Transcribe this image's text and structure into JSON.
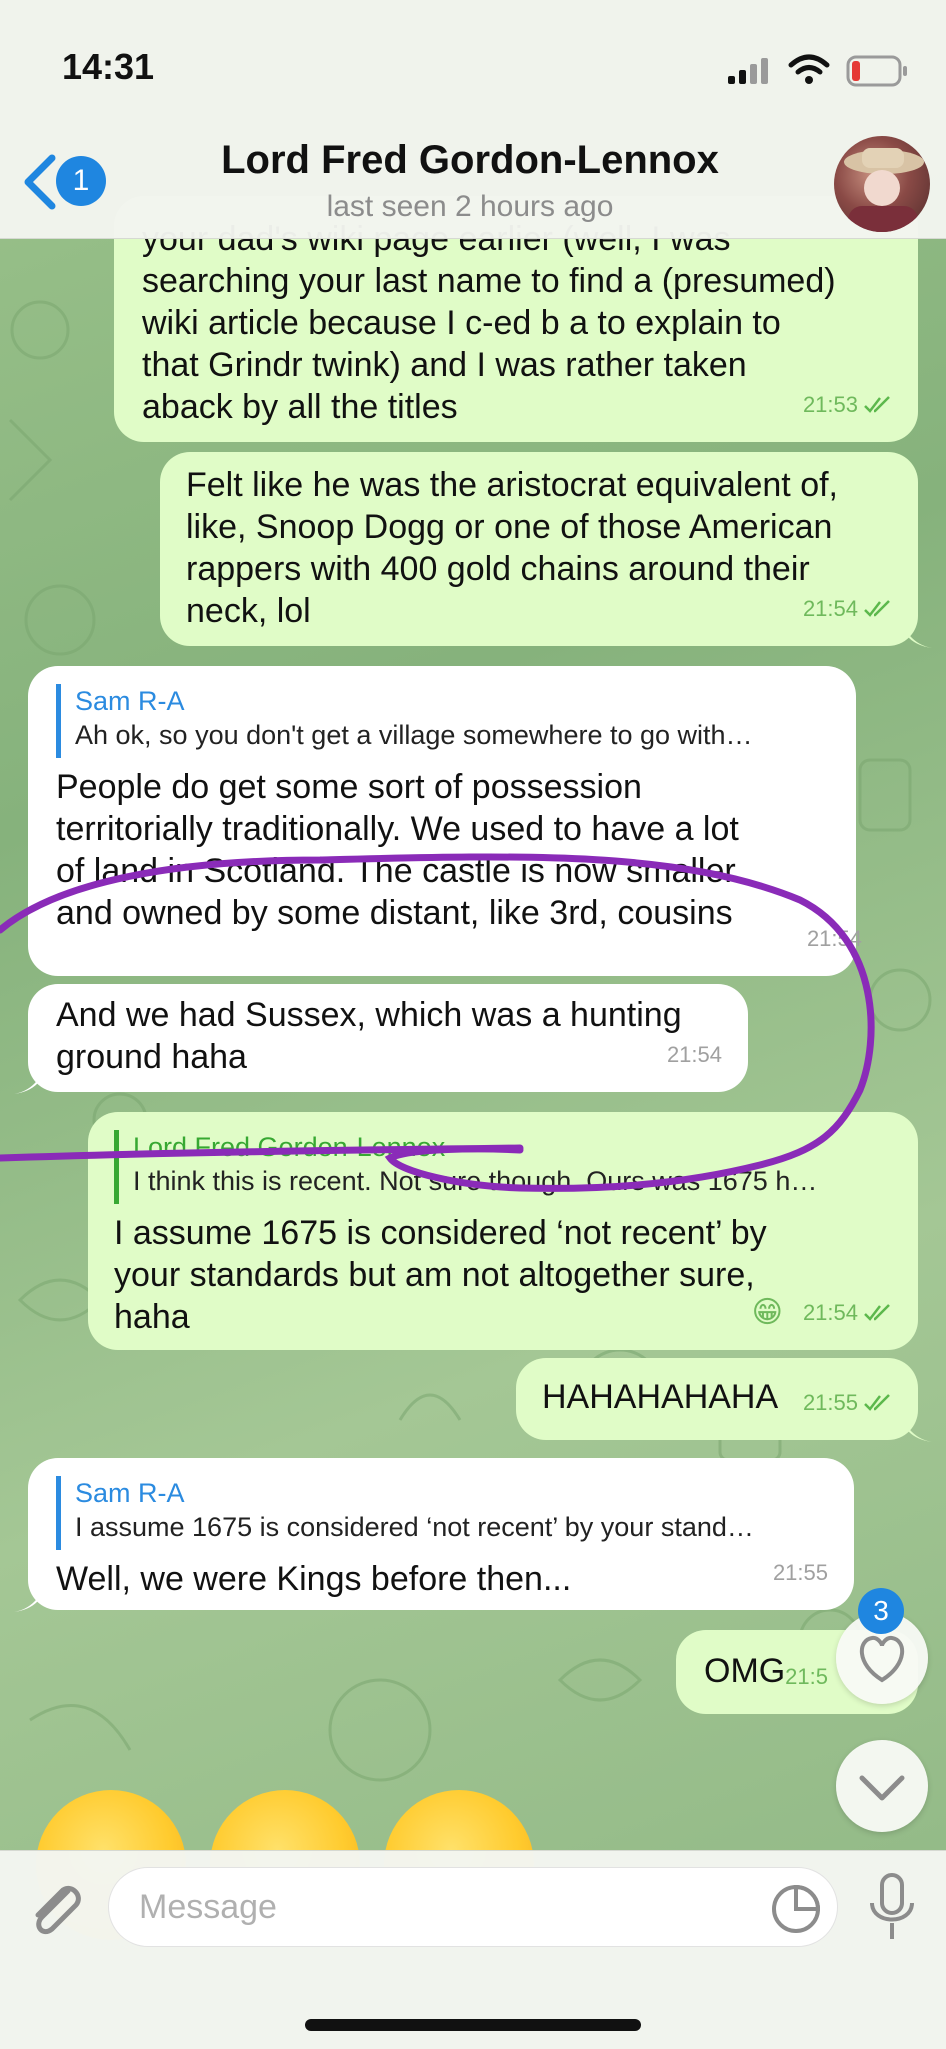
{
  "status_bar": {
    "time": "14:31"
  },
  "header": {
    "back_count": "1",
    "contact_name": "Lord Fred Gordon-Lennox",
    "last_seen": "last seen 2 hours ago"
  },
  "messages": [
    {
      "direction": "outgoing",
      "text_lines": [
        "your dad's wiki page earlier (well, I was",
        "searching your last name to find a (presumed)",
        "wiki article because I c-ed b a to explain to",
        "that Grindr twink) and I was rather taken",
        "aback by all the titles"
      ],
      "time": "21:53"
    },
    {
      "direction": "outgoing",
      "text_lines": [
        "Felt like he was the aristocrat equivalent of,",
        "like, Snoop Dogg or one of those American",
        "rappers with 400 gold chains around their",
        "neck, lol"
      ],
      "time": "21:54"
    },
    {
      "direction": "incoming",
      "reply_name": "Sam R-A",
      "reply_text": "Ah ok, so you don't get a village somewhere to go with…",
      "text_lines": [
        "People do get some sort of possession",
        "territorially traditionally. We used to have a lot",
        "of land in Scotland. The castle is now smaller",
        "and owned by some distant, like 3rd, cousins"
      ],
      "time": "21:54"
    },
    {
      "direction": "incoming",
      "text_lines": [
        "And we had Sussex, which was a hunting",
        "ground haha"
      ],
      "time": "21:54"
    },
    {
      "direction": "outgoing",
      "reply_name": "Lord Fred Gordon-Lennox",
      "reply_text": "I think this is recent. Not sure though. Ours was 1675 h…",
      "text_lines": [
        "I assume 1675 is considered ‘not recent’ by",
        "your standards but am not altogether sure,",
        "haha"
      ],
      "reaction": "😁",
      "time": "21:54"
    },
    {
      "direction": "outgoing",
      "text_lines": [
        "HAHAHAHAHA"
      ],
      "time": "21:55"
    },
    {
      "direction": "incoming",
      "reply_name": "Sam R-A",
      "reply_text": "I assume 1675 is considered ‘not recent’ by your stand…",
      "text_lines": [
        "Well, we were Kings before then..."
      ],
      "time": "21:55"
    },
    {
      "direction": "outgoing",
      "text_lines": [
        "OMG"
      ],
      "time": "21:5"
    }
  ],
  "reactions_button": {
    "badge": "3",
    "icon": "heart-icon"
  },
  "scroll_down_button": {
    "icon": "chevron-down-icon"
  },
  "input": {
    "placeholder": "Message"
  },
  "colors": {
    "outgoing_bubble": "#e0fcc7",
    "incoming_bubble": "#ffffff",
    "accent": "#1f86e0",
    "annotation": "#8a2bb8"
  }
}
